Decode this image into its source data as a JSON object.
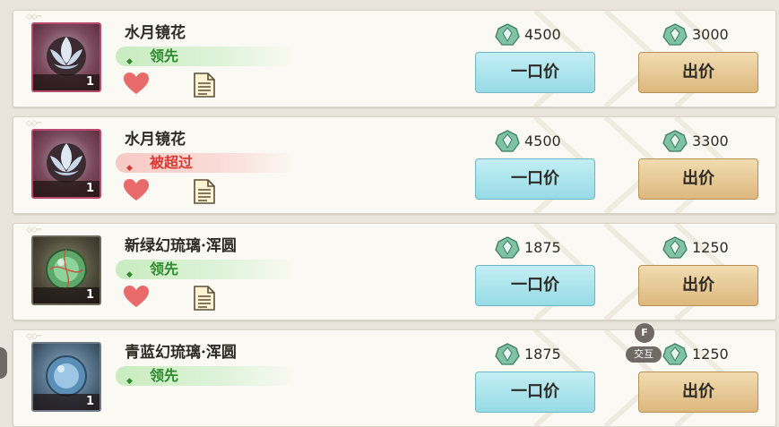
{
  "listings": [
    {
      "name": "水月镜花",
      "status": "领先",
      "status_type": "lead",
      "quantity": "1",
      "thumb": "pink",
      "buyout_price": "4500",
      "bid_price": "3000",
      "buyout_label": "一口价",
      "bid_label": "出价"
    },
    {
      "name": "水月镜花",
      "status": "被超过",
      "status_type": "out",
      "quantity": "1",
      "thumb": "pink",
      "buyout_price": "4500",
      "bid_price": "3300",
      "buyout_label": "一口价",
      "bid_label": "出价"
    },
    {
      "name": "新绿幻琉璃·浑圆",
      "status": "领先",
      "status_type": "lead",
      "quantity": "1",
      "thumb": "green",
      "buyout_price": "1875",
      "bid_price": "1250",
      "buyout_label": "一口价",
      "bid_label": "出价"
    },
    {
      "name": "青蓝幻琉璃·浑圆",
      "status": "领先",
      "status_type": "lead",
      "quantity": "1",
      "thumb": "blue",
      "buyout_price": "1875",
      "bid_price": "1250",
      "buyout_label": "一口价",
      "bid_label": "出价"
    }
  ],
  "interact_hint": {
    "key": "F",
    "label": "交互"
  },
  "colors": {
    "lead": "#2e8b2e",
    "outbid": "#d63b32",
    "buyout_button": "#96dbe6",
    "bid_button": "#ddb87d",
    "heart": "#e86a6a"
  },
  "icons": {
    "currency": "jade-gem-icon",
    "favorite": "heart-icon",
    "details": "document-icon"
  }
}
